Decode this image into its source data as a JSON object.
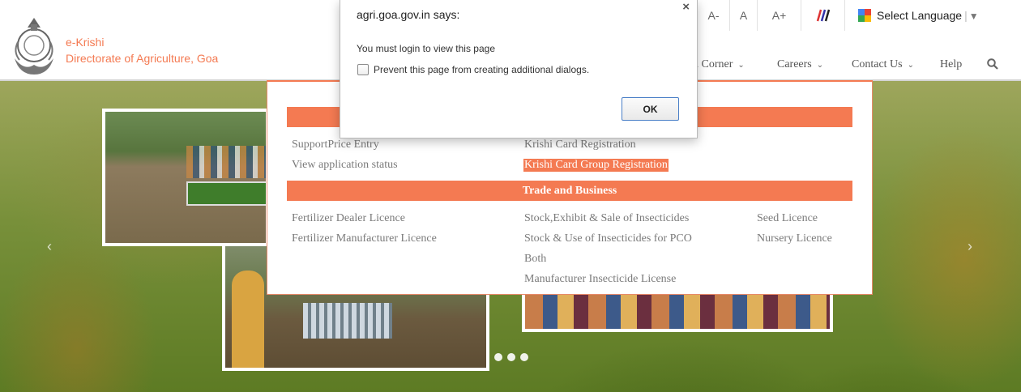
{
  "brand": {
    "line1": "e-Krishi",
    "line2": "Directorate of Agriculture, Goa",
    "accent_color": "#f47a52"
  },
  "toolbar": {
    "font_decrease": "A-",
    "font_normal": "A",
    "font_increase": "A+",
    "language": {
      "label": "Select Language",
      "separator": "|",
      "arrow": "▼"
    }
  },
  "nav": {
    "items": [
      {
        "label": "n Corner"
      },
      {
        "label": "Careers"
      },
      {
        "label": "Contact Us"
      },
      {
        "label": "Help"
      }
    ],
    "chevron": "⌵"
  },
  "mega_menu": {
    "section1": {
      "header": "",
      "col1": [
        "SupportPrice Entry",
        "View application status"
      ],
      "col2": [
        "Krishi Card Registration",
        "Krishi Card Group Registration"
      ]
    },
    "section2": {
      "header": "Trade and Business",
      "col1": [
        "Fertilizer Dealer Licence",
        "Fertilizer Manufacturer Licence"
      ],
      "col2": [
        "Stock,Exhibit & Sale of Insecticides",
        "Stock & Use of Insecticides for PCO",
        "Both",
        "Manufacturer Insecticide License"
      ],
      "col3": [
        "Seed Licence",
        "Nursery Licence"
      ]
    }
  },
  "dialog": {
    "title": "agri.goa.gov.in says:",
    "close": "×",
    "message": "You must login to view this page",
    "checkbox_label": "Prevent this page from creating additional dialogs.",
    "ok_label": "OK"
  },
  "carousel": {
    "prev": "‹",
    "next": "›",
    "dots": 3
  }
}
